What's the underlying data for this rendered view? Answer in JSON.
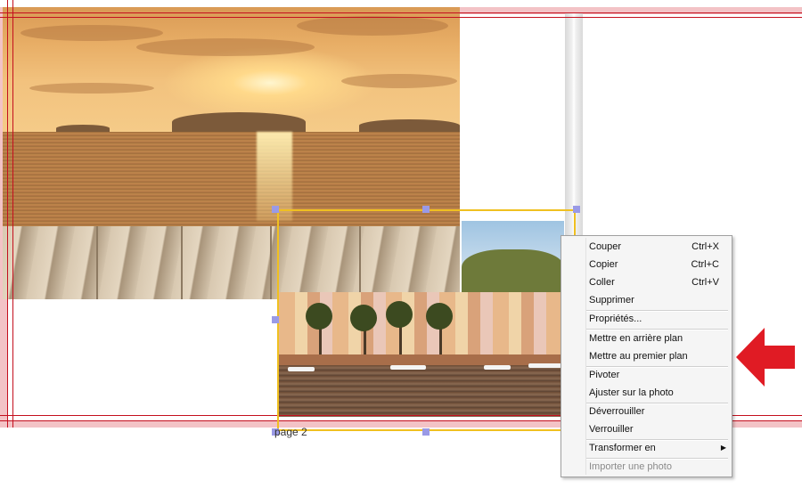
{
  "page": {
    "label": "page 2"
  },
  "context_menu": {
    "items": [
      {
        "label": "Couper",
        "shortcut": "Ctrl+X"
      },
      {
        "label": "Copier",
        "shortcut": "Ctrl+C"
      },
      {
        "label": "Coller",
        "shortcut": "Ctrl+V"
      },
      {
        "label": "Supprimer",
        "shortcut": ""
      },
      {
        "label": "Propriétés...",
        "shortcut": ""
      },
      {
        "label": "Mettre en arrière plan",
        "shortcut": ""
      },
      {
        "label": "Mettre au premier plan",
        "shortcut": ""
      },
      {
        "label": "Pivoter",
        "shortcut": ""
      },
      {
        "label": "Ajuster sur la photo",
        "shortcut": ""
      },
      {
        "label": "Déverrouiller",
        "shortcut": ""
      },
      {
        "label": "Verrouiller",
        "shortcut": ""
      },
      {
        "label": "Transformer en",
        "shortcut": ""
      },
      {
        "label": "Importer une photo",
        "shortcut": ""
      }
    ]
  },
  "colors": {
    "selection_border": "#f0c020",
    "handle": "#9a9ae6",
    "guide": "#c40f1e",
    "bleed": "#f3c3c6",
    "arrow": "#e01b24"
  },
  "icons": {
    "arrow": "left-arrow-icon",
    "submenu": "chevron-right-icon"
  }
}
